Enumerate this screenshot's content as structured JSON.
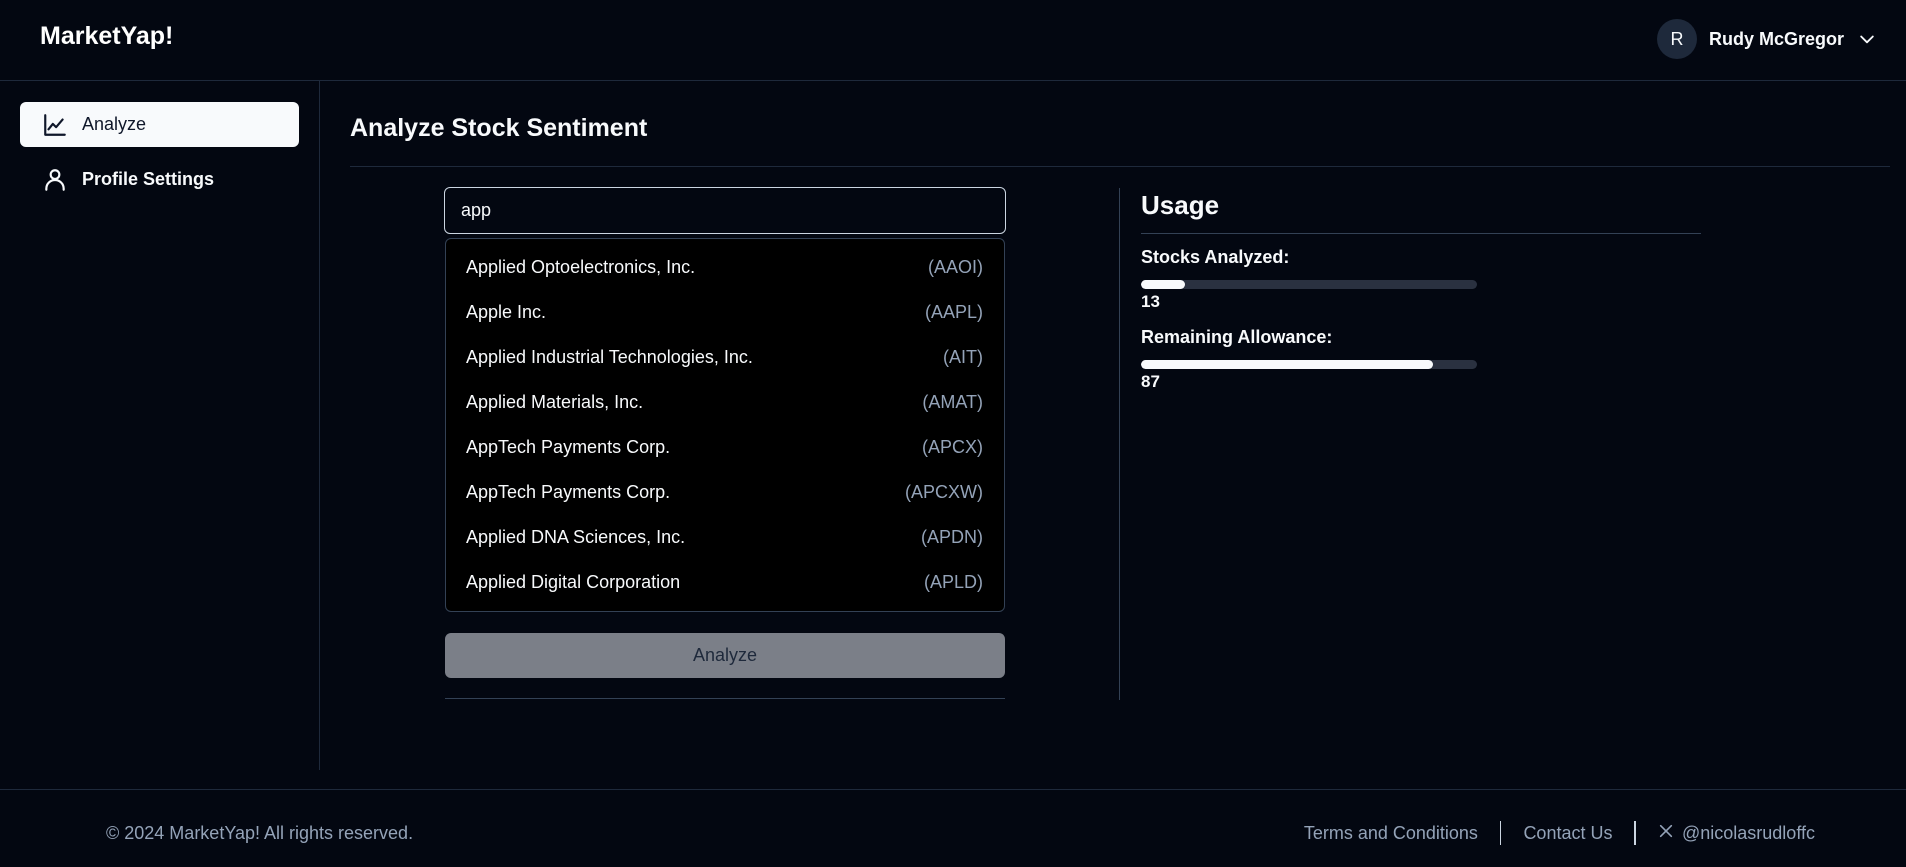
{
  "app": {
    "title": "MarketYap!"
  },
  "user": {
    "initial": "R",
    "name": "Rudy McGregor"
  },
  "sidebar": {
    "items": [
      {
        "label": "Analyze",
        "icon": "line-chart-icon",
        "active": true
      },
      {
        "label": "Profile Settings",
        "icon": "user-icon",
        "active": false
      }
    ]
  },
  "main": {
    "title": "Analyze Stock Sentiment",
    "search": {
      "value": "app",
      "placeholder": ""
    },
    "results": [
      {
        "name": "Applied Optoelectronics, Inc.",
        "symbol": "(AAOI)"
      },
      {
        "name": "Apple Inc.",
        "symbol": "(AAPL)"
      },
      {
        "name": "Applied Industrial Technologies, Inc.",
        "symbol": "(AIT)"
      },
      {
        "name": "Applied Materials, Inc.",
        "symbol": "(AMAT)"
      },
      {
        "name": "AppTech Payments Corp.",
        "symbol": "(APCX)"
      },
      {
        "name": "AppTech Payments Corp.",
        "symbol": "(APCXW)"
      },
      {
        "name": "Applied DNA Sciences, Inc.",
        "symbol": "(APDN)"
      },
      {
        "name": "Applied Digital Corporation",
        "symbol": "(APLD)"
      }
    ],
    "analyze_label": "Analyze"
  },
  "usage": {
    "title": "Usage",
    "stocks_analyzed": {
      "label": "Stocks Analyzed:",
      "value": "13",
      "percent": 13
    },
    "remaining": {
      "label": "Remaining Allowance:",
      "value": "87",
      "percent": 87
    }
  },
  "footer": {
    "copyright": "© 2024 MarketYap! All rights reserved.",
    "terms": "Terms and Conditions",
    "contact": "Contact Us",
    "twitter": "@nicolasrudloffc"
  },
  "colors": {
    "background": "#030711",
    "foreground": "#f8fafc",
    "muted": "#94a3b8",
    "button_disabled": "#7b7f88"
  }
}
